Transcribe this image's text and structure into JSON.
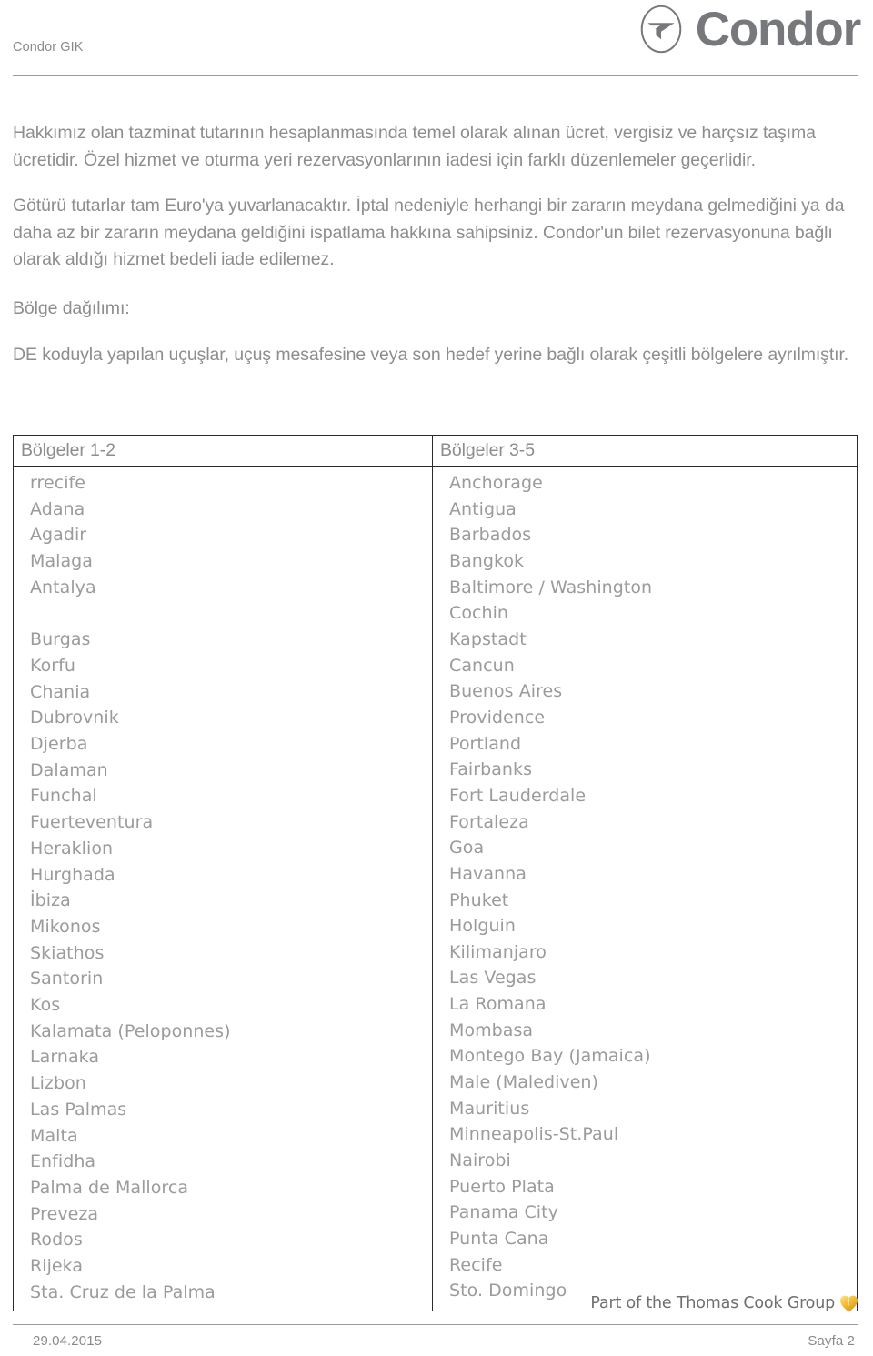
{
  "header": {
    "doc_label": "Condor GIK",
    "brand_name": "Condor",
    "brand_mark_icon": "condor-circle-bird-logo",
    "brand_color": "#77787b"
  },
  "content": {
    "paragraph_1": "Hakkımız olan tazminat tutarının hesaplanmasında temel olarak alınan ücret, vergisiz ve harçsız taşıma ücretidir. Özel hizmet ve oturma yeri rezervasyonlarının iadesi için farklı düzenlemeler geçerlidir.",
    "paragraph_2": "Götürü tutarlar tam Euro'ya yuvarlanacaktır. İptal nedeniyle herhangi bir zararın meydana gelmediğini ya da daha az bir zararın meydana geldiğini ispatlama hakkına sahipsiniz. Condor'un bilet rezervasyonuna bağlı olarak aldığı hizmet bedeli iade edilemez.",
    "section_label": "Bölge dağılımı:",
    "paragraph_3": "DE koduyla yapılan uçuşlar, uçuş mesafesine veya son hedef yerine bağlı olarak çeşitli bölgelere ayrılmıştır."
  },
  "table": {
    "columns": [
      {
        "header": "Bölgeler 1-2",
        "cities": [
          "rrecife",
          "Adana",
          "Agadir",
          "Malaga",
          "Antalya",
          "Burgas",
          "Korfu",
          "Chania",
          "Dubrovnik",
          "Djerba",
          "Dalaman",
          "Funchal",
          "Fuerteventura",
          "Heraklion",
          "Hurghada",
          "İbiza",
          "Mikonos",
          "Skiathos",
          "Santorin",
          "Kos",
          "Kalamata (Peloponnes)",
          "Larnaka",
          "Lizbon",
          "Las Palmas",
          "Malta",
          "Enfidha",
          "Palma de Mallorca",
          "Preveza",
          "Rodos",
          "Rijeka",
          "Sta. Cruz de la Palma"
        ],
        "gap_after_index": 4
      },
      {
        "header": "Bölgeler 3-5",
        "cities": [
          "Anchorage",
          "Antigua",
          "Barbados",
          "Bangkok",
          "Baltimore / Washington",
          "Cochin",
          "Kapstadt",
          "Cancun",
          "Buenos Aires",
          "Providence",
          "Portland",
          "Fairbanks",
          "Fort Lauderdale",
          "Fortaleza",
          "Goa",
          "Havanna",
          "Phuket",
          "Holguin",
          "Kilimanjaro",
          "Las Vegas",
          "La Romana",
          "Mombasa",
          "Montego Bay (Jamaica)",
          "Male (Malediven)",
          "Mauritius",
          "Minneapolis-St.Paul",
          "Nairobi",
          "Puerto Plata",
          "Panama City",
          "Punta Cana",
          "Recife",
          "Sto. Domingo"
        ],
        "gap_after_index": -1
      }
    ]
  },
  "footer": {
    "group_text": "Part of the Thomas Cook Group",
    "heart_icon": "thomas-cook-heart-icon",
    "heart_color": "#f2b632",
    "date": "29.04.2015",
    "page": "Sayfa 2"
  }
}
